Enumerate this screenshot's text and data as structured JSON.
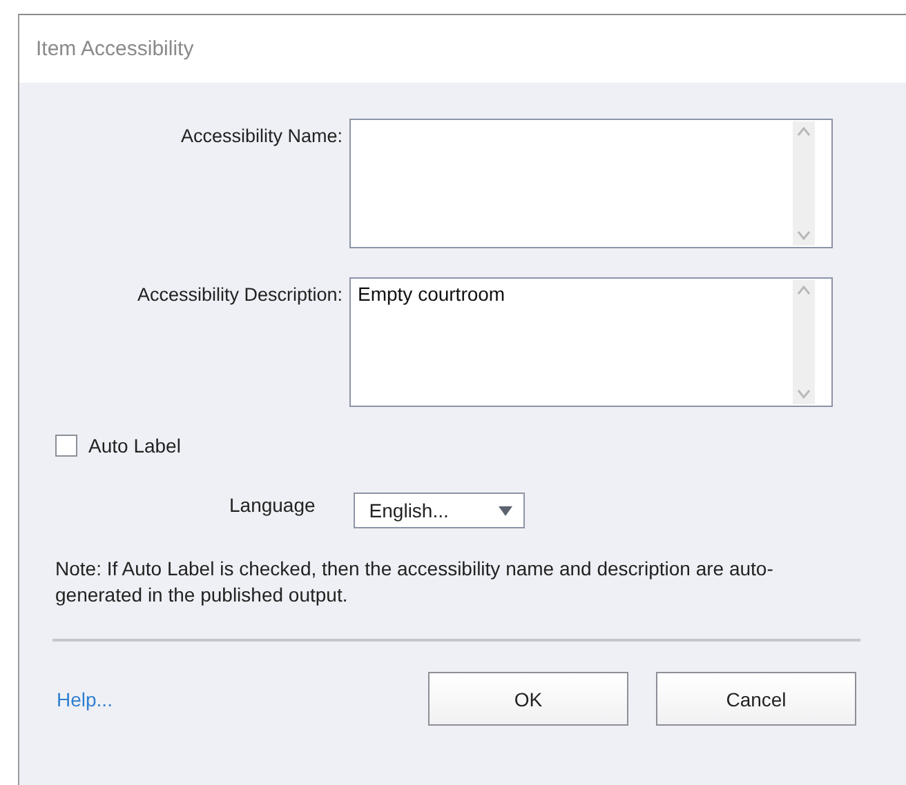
{
  "window": {
    "title": "Item Accessibility"
  },
  "fields": [
    {
      "label": "Accessibility Name:"
    },
    {
      "label": "Accessibility Description:",
      "value": "Empty courtroom"
    }
  ],
  "auto_label": {
    "label": "Auto Label",
    "checked": false
  },
  "language": {
    "label": "Language",
    "value": "English..."
  },
  "note": "Note: If Auto Label is checked, then the accessibility name and description are auto-generated in the published output.",
  "help_link": "Help...",
  "buttons": [
    "OK",
    "Cancel"
  ]
}
